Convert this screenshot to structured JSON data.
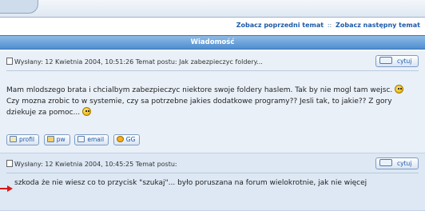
{
  "topic_nav": {
    "prev_label": "Zobacz poprzedni temat",
    "separator": "::",
    "next_label": "Zobacz następny temat"
  },
  "section_header": "Wiadomość",
  "posts": [
    {
      "meta": "Wysłany: 12 Kwietnia 2004, 10:51:26   Temat postu: Jak zabezpieczyc foldery...",
      "quote_label": "cytuj",
      "body_part1": "Mam mlodszego brata i chcialbym zabezpieczyc niektore swoje foldery haslem. Tak by nie mogl tam wejsc.",
      "body_part2": "Czy mozna zrobic to w systemie, czy sa potrzebne jakies dodatkowe programy?? Jesli tak, to jakie?? Z gory dziekuje za pomoc...",
      "buttons": {
        "profile": "profil",
        "pm": "pw",
        "email": "email",
        "gg": "GG"
      }
    },
    {
      "meta": "Wysłany: 12 Kwietnia 2004, 10:45:25   Temat postu:",
      "quote_label": "cytuj",
      "body": "szkoda że nie wiesz co to przycisk \"szukaj\"... było poruszana na forum wielokrotnie, jak nie więcej"
    }
  ],
  "colors": {
    "header_blue": "#4f8ed0",
    "link_blue": "#1c5aa8",
    "post_bg": "#e9f0f8",
    "arrow_red": "#d81818"
  }
}
